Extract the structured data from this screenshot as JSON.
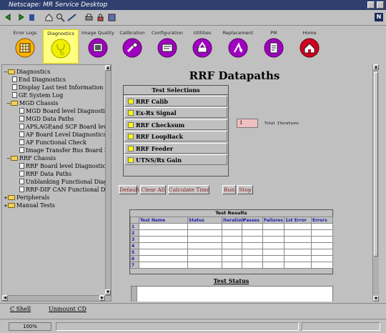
{
  "window": {
    "title": "Netscape: MR Service Desktop"
  },
  "nav": {
    "items": [
      {
        "label": "Error Logs",
        "icon": "calendar-grid-icon",
        "color": "#ffb300"
      },
      {
        "label": "Diagnostics",
        "icon": "stethoscope-icon",
        "color": "#f0f000",
        "active": true
      },
      {
        "label": "Image Quality",
        "icon": "image-quality-icon",
        "color": "#a000c0"
      },
      {
        "label": "Calibration",
        "icon": "calibration-icon",
        "color": "#a000c0"
      },
      {
        "label": "Configuration",
        "icon": "configuration-icon",
        "color": "#a000c0"
      },
      {
        "label": "Utilities",
        "icon": "utilities-icon",
        "color": "#a000c0"
      },
      {
        "label": "Replacement",
        "icon": "replacement-icon",
        "color": "#a000c0"
      },
      {
        "label": "PM",
        "icon": "pm-icon",
        "color": "#a000c0"
      },
      {
        "label": "Home",
        "icon": "home-icon",
        "color": "#d00020"
      }
    ]
  },
  "tree": {
    "items": [
      {
        "label": "Diagnostics",
        "type": "folder",
        "level": 0,
        "expanded": true
      },
      {
        "label": "End Diagnostics",
        "type": "doc",
        "level": 1
      },
      {
        "label": "Display Last test Information",
        "type": "doc",
        "level": 1
      },
      {
        "label": "GE System Log",
        "type": "doc",
        "level": 1
      },
      {
        "label": "MGD Chassis",
        "type": "folder",
        "level": 1,
        "expanded": true
      },
      {
        "label": "MGD Board level Diagnostics",
        "type": "doc",
        "level": 2
      },
      {
        "label": "MGD Data Paths",
        "type": "doc",
        "level": 2
      },
      {
        "label": "APS,AGP,and SCP Board level",
        "type": "doc",
        "level": 2
      },
      {
        "label": "AP Board Level Diagnostics",
        "type": "doc",
        "level": 2
      },
      {
        "label": "AP Functional Check",
        "type": "doc",
        "level": 2
      },
      {
        "label": "Image Transfer Bus Board Leve",
        "type": "doc",
        "level": 2
      },
      {
        "label": "RRF Chassis",
        "type": "folder",
        "level": 1,
        "expanded": true
      },
      {
        "label": "RRF Board level Diagnostics",
        "type": "doc",
        "level": 2
      },
      {
        "label": "RRF Data Paths",
        "type": "doc",
        "level": 2
      },
      {
        "label": "Unblanking Functional Diagnos",
        "type": "doc",
        "level": 2
      },
      {
        "label": "RRF-DIF CAN Functional Dia",
        "type": "doc",
        "level": 2
      },
      {
        "label": "Peripherals",
        "type": "folder",
        "level": 0,
        "expanded": false
      },
      {
        "label": "Manual Tests",
        "type": "folder",
        "level": 0,
        "expanded": false
      }
    ]
  },
  "main": {
    "title": "RRF Datapaths",
    "selections_header": "Test Selections",
    "selections": [
      "RRF Calib",
      "Ex-Rx Signal",
      "RRF Checksum",
      "RRF LoopBack",
      "RRF Feeder",
      "UTNS/Rx Gain"
    ],
    "iterations_value": "1",
    "iterations_label": "Total Iterations",
    "buttons": {
      "default": "Default",
      "clear_all": "Clear All",
      "calculate_time": "Calculate Time",
      "run": "Run",
      "stop": "Stop"
    },
    "results": {
      "title": "Test Results",
      "columns": [
        "Test Name",
        "Status",
        "Iteration",
        "Passes",
        "Failures",
        "1st Error",
        "Errors"
      ],
      "rows": [
        "1",
        "2",
        "3",
        "4",
        "5",
        "6",
        "7"
      ]
    },
    "status_title": "Test Status"
  },
  "bottom": {
    "c_shell": "C Shell",
    "unmount_cd": "Unmount CD"
  },
  "statusbar": {
    "zoom": "100%"
  }
}
